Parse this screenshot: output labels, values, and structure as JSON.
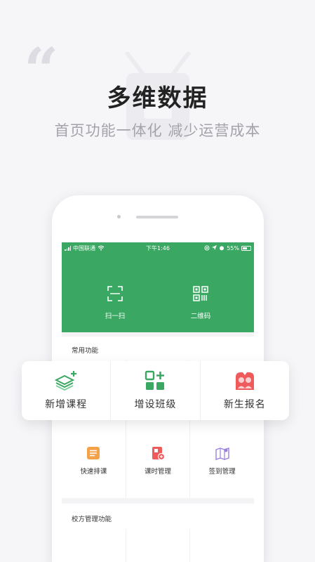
{
  "headline": "多维数据",
  "subline": "首页功能一体化 减少运营成本",
  "status_bar": {
    "carrier": "中国联通",
    "time": "下午1:46",
    "battery": "55%"
  },
  "hero": {
    "scan_label": "扫一扫",
    "qr_label": "二维码"
  },
  "common_section_title": "常用功能",
  "feature_card": [
    {
      "label": "新增课程",
      "icon": "books-plus-icon"
    },
    {
      "label": "增设班级",
      "icon": "grid-plus-icon"
    },
    {
      "label": "新生报名",
      "icon": "signup-icon"
    }
  ],
  "common_row": [
    {
      "label": "快速排课",
      "icon": "schedule-icon"
    },
    {
      "label": "课时管理",
      "icon": "hours-icon"
    },
    {
      "label": "签到管理",
      "icon": "checkin-map-icon"
    }
  ],
  "school_section_title": "校方管理功能",
  "colors": {
    "brand_green": "#3aa862",
    "orange": "#f4a24a",
    "red": "#ef5a5a",
    "purple": "#9b7fe0"
  }
}
